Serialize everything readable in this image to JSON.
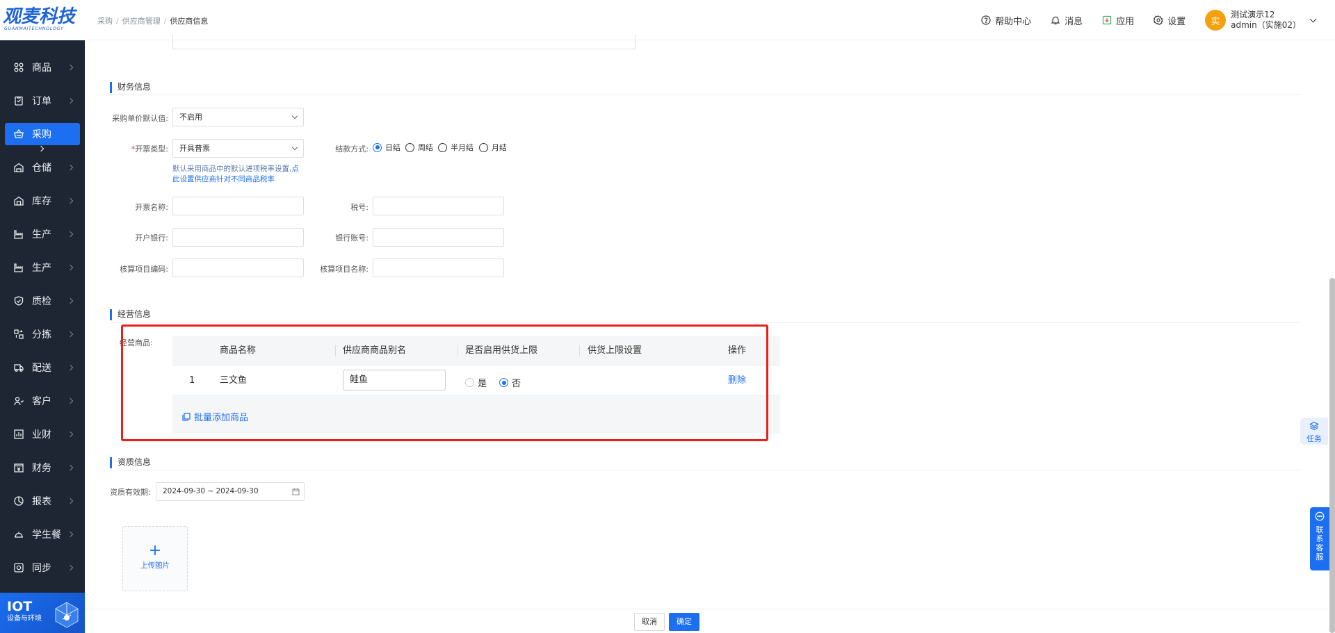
{
  "logo": {
    "main": "观麦科技",
    "sub": "GUANMAITECHNOLOGY"
  },
  "sidebar": {
    "items": [
      {
        "label": "商品",
        "icon": "grid-icon"
      },
      {
        "label": "订单",
        "icon": "order-icon"
      },
      {
        "label": "采购",
        "icon": "basket-icon",
        "active": true
      },
      {
        "label": "仓储",
        "icon": "warehouse-icon"
      },
      {
        "label": "库存",
        "icon": "inventory-icon"
      },
      {
        "label": "生产",
        "icon": "factory-icon"
      },
      {
        "label": "生产",
        "icon": "factory-icon"
      },
      {
        "label": "质检",
        "icon": "shield-icon"
      },
      {
        "label": "分拣",
        "icon": "sort-icon"
      },
      {
        "label": "配送",
        "icon": "truck-icon"
      },
      {
        "label": "客户",
        "icon": "users-icon"
      },
      {
        "label": "业财",
        "icon": "bar-chart-icon"
      },
      {
        "label": "财务",
        "icon": "finance-icon"
      },
      {
        "label": "报表",
        "icon": "pie-chart-icon"
      },
      {
        "label": "学生餐",
        "icon": "meal-icon"
      },
      {
        "label": "同步",
        "icon": "sync-icon"
      }
    ],
    "iot": {
      "title": "IOT",
      "subtitle": "设备与环境"
    }
  },
  "header": {
    "breadcrumb": [
      "采购",
      "供应商管理",
      "供应商信息"
    ],
    "help": "帮助中心",
    "messages": "消息",
    "apps": "应用",
    "settings": "设置",
    "user": {
      "avatar": "实",
      "name": "测试演示12",
      "account": "admin（实施02）"
    }
  },
  "finance": {
    "title": "财务信息",
    "price_default_label": "采购单价默认值:",
    "price_default_value": "不启用",
    "invoice_type_label": "开票类型:",
    "invoice_type_value": "开具普票",
    "invoice_hint_1": "默认采用商品中的默认进项税率设置,",
    "invoice_hint_link_1": "点",
    "invoice_hint_link_2": "此设置供应商针对不同商品税率",
    "settlement_label": "结款方式:",
    "settlement_options": [
      "日结",
      "周结",
      "半月结",
      "月结"
    ],
    "settlement_selected": "日结",
    "invoice_name_label": "开票名称:",
    "tax_no_label": "税号:",
    "bank_label": "开户银行:",
    "bank_account_label": "银行账号:",
    "account_code_label": "核算项目编码:",
    "account_name_label": "核算项目名称:"
  },
  "business": {
    "title": "经营信息",
    "goods_label": "经营商品:",
    "columns": [
      "商品名称",
      "供应商商品别名",
      "是否启用供货上限",
      "供货上限设置",
      "操作"
    ],
    "rows": [
      {
        "index": "1",
        "name": "三文鱼",
        "alias": "鲑鱼",
        "limit_yes": "是",
        "limit_no": "否",
        "limit_selected": "否",
        "action": "删除"
      }
    ],
    "batch_add": "批量添加商品"
  },
  "qualification": {
    "title": "资质信息",
    "validity_label": "资质有效期:",
    "validity_value": "2024-09-30 ~ 2024-09-30",
    "upload_label": "上传图片"
  },
  "footer": {
    "cancel": "取消",
    "confirm": "确定"
  },
  "floating": {
    "task": "任务",
    "service": [
      "联",
      "系",
      "客",
      "服"
    ]
  },
  "colors": {
    "primary": "#1d6ff2",
    "sidebar_bg": "#1f2633",
    "highlight": "#e62117",
    "avatar": "#f6a10c"
  }
}
